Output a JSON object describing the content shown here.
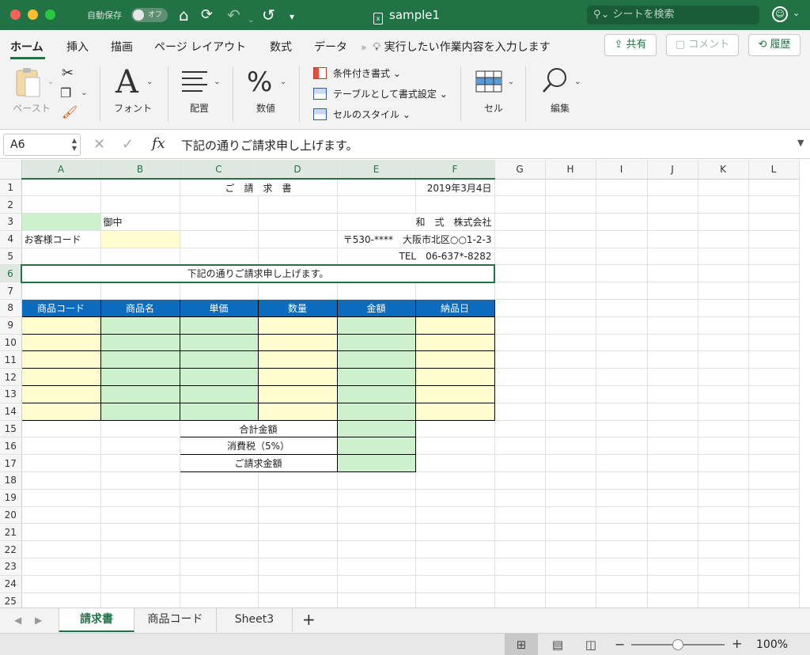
{
  "titlebar": {
    "autosave_label": "自動保存",
    "toggle_state": "オフ",
    "doc_title": "sample1",
    "search_placeholder": "シートを検索"
  },
  "ribbon_tabs": {
    "home": "ホーム",
    "insert": "挿入",
    "draw": "描画",
    "page_layout": "ページ レイアウト",
    "formulas": "数式",
    "data": "データ",
    "tell_me": "実行したい作業内容を入力します",
    "share": "共有",
    "comment": "コメント",
    "history": "履歴"
  },
  "ribbon": {
    "paste": "ペースト",
    "font": "フォント",
    "alignment": "配置",
    "number": "数値",
    "conditional_format": "条件付き書式",
    "format_as_table": "テーブルとして書式設定",
    "cell_styles": "セルのスタイル",
    "cells": "セル",
    "editing": "編集"
  },
  "formula_bar": {
    "name_box": "A6",
    "fx": "fx",
    "formula": "下記の通りご請求申し上げます。"
  },
  "grid": {
    "columns": [
      "A",
      "B",
      "C",
      "D",
      "E",
      "F",
      "G",
      "H",
      "I",
      "J",
      "K",
      "L"
    ],
    "rows": [
      "1",
      "2",
      "3",
      "4",
      "5",
      "6",
      "7",
      "8",
      "9",
      "10",
      "11",
      "12",
      "13",
      "14",
      "15",
      "16",
      "17",
      "18",
      "19",
      "20",
      "21",
      "22",
      "23",
      "24",
      "25"
    ],
    "cells": {
      "C1": "ご　請　求　書",
      "F1": "2019年3月4日",
      "B3": "御中",
      "E3": "和　弍　株式会社",
      "A4": "お客様コード",
      "E4": "〒530-****　大阪市北区○○1-2-3",
      "E5": "TEL　06-637*-8282",
      "A6": "下記の通りご請求申し上げます。",
      "A8": "商品コード",
      "B8": "商品名",
      "C8": "単価",
      "D8": "数量",
      "E8": "金額",
      "F8": "納品日",
      "C15": "合計金額",
      "C16": "消費税（5%）",
      "C17": "ご請求金額"
    }
  },
  "sheet_tabs": {
    "tab1": "請求書",
    "tab2": "商品コード",
    "tab3": "Sheet3",
    "add": "+"
  },
  "status": {
    "zoom": "100%"
  },
  "colors": {
    "accent": "#217346",
    "header_blue": "#0b6bbf",
    "cell_green": "#cdf1cc",
    "cell_yellow": "#fffcd0"
  }
}
